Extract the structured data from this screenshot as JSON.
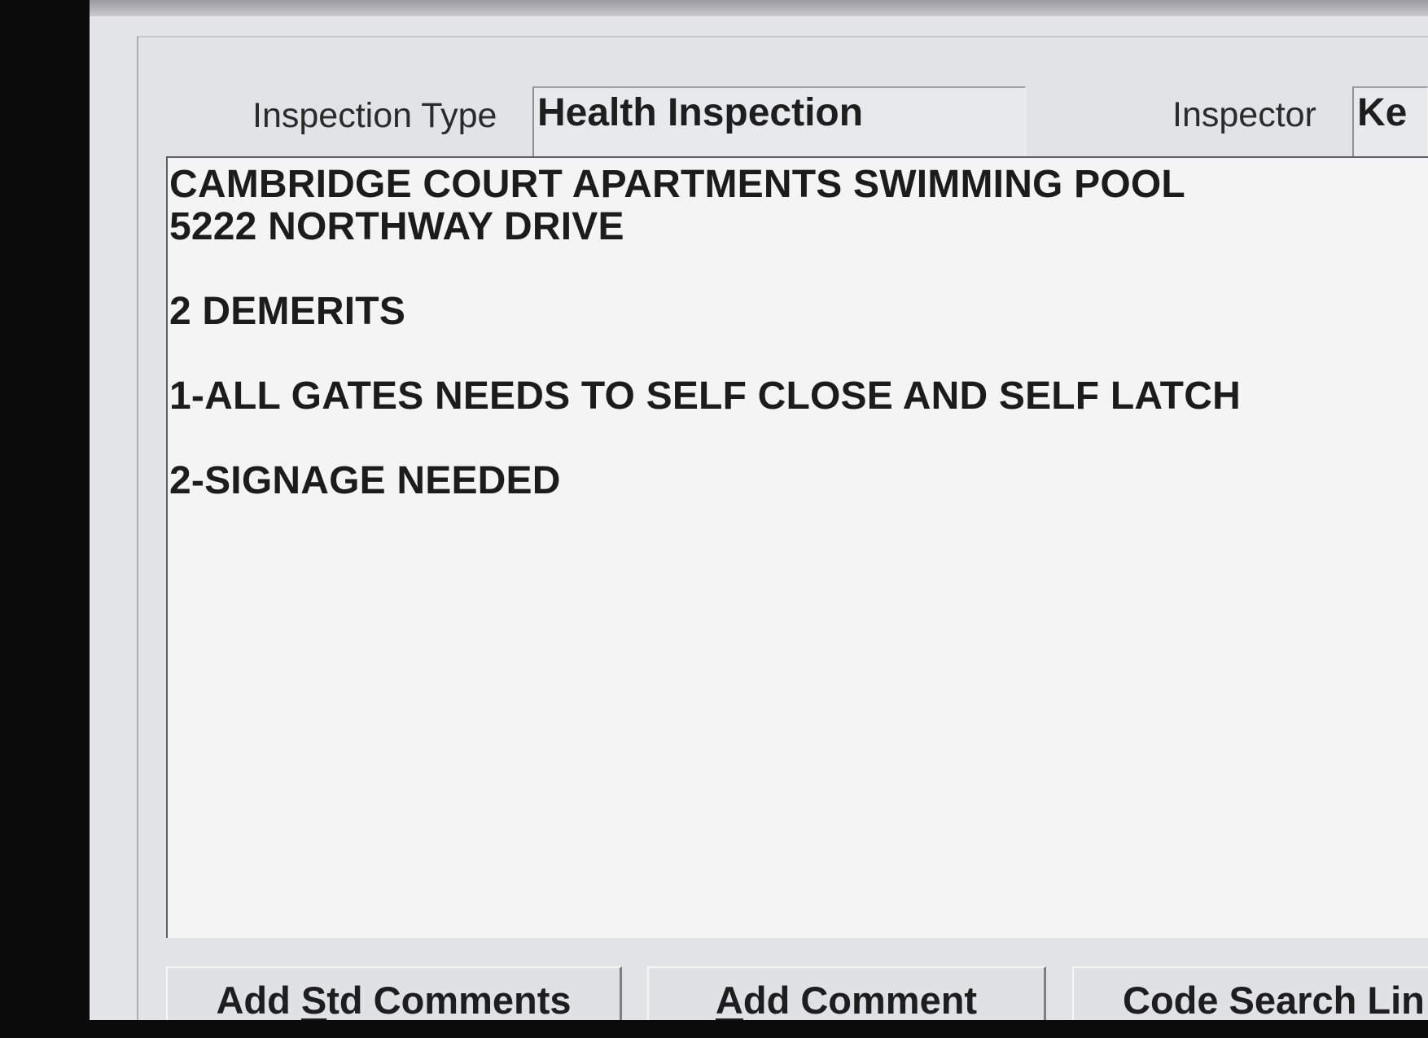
{
  "form": {
    "inspection_type_label": "Inspection Type",
    "inspection_type_value": "Health Inspection",
    "inspector_label": "Inspector",
    "inspector_value": "Ke"
  },
  "comments": {
    "lines": [
      "CAMBRIDGE COURT APARTMENTS SWIMMING POOL",
      "5222 NORTHWAY DRIVE",
      "",
      "2 DEMERITS",
      "",
      "1-ALL GATES NEEDS TO SELF CLOSE AND SELF LATCH",
      "",
      "2-SIGNAGE NEEDED"
    ]
  },
  "buttons": {
    "add_std_comments": {
      "pre": "Add ",
      "mnemonic": "S",
      "post": "td Comments"
    },
    "add_comment": {
      "pre": "",
      "mnemonic": "A",
      "post": "dd Comment"
    },
    "code_search": {
      "label": "Code Search Lin"
    }
  }
}
